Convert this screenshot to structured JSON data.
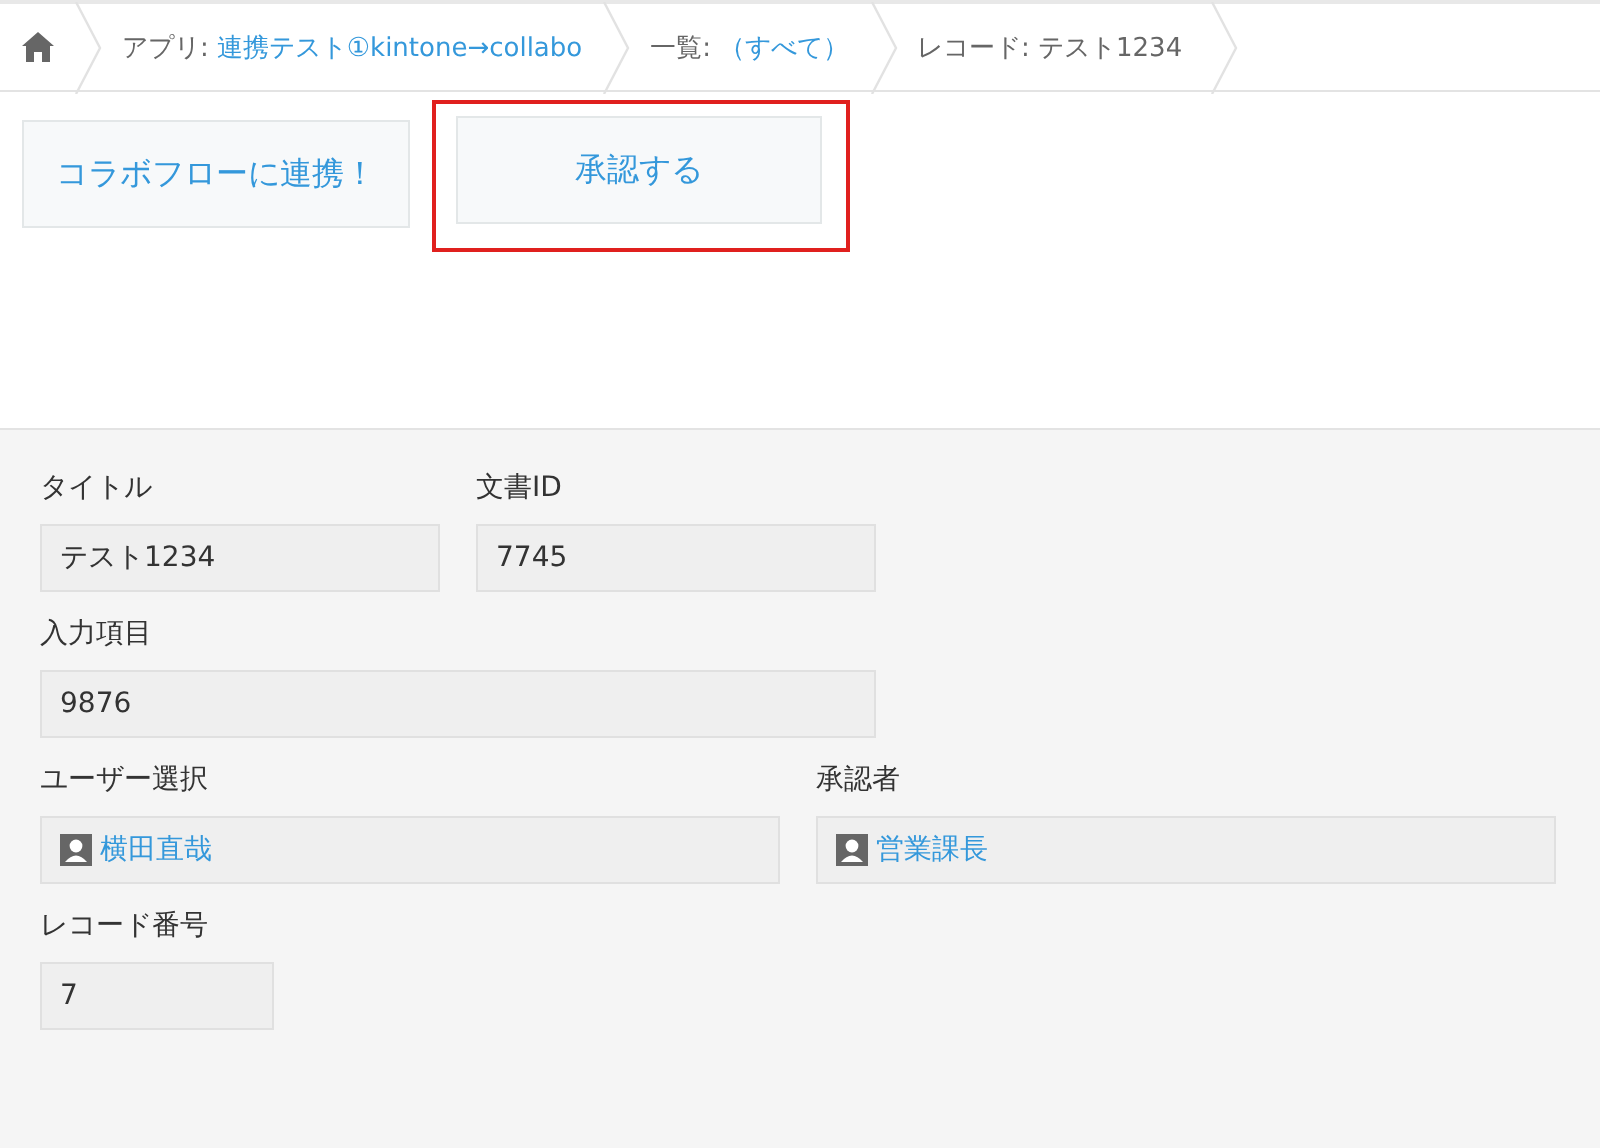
{
  "breadcrumb": [
    {
      "kind": "home"
    },
    {
      "kind": "link",
      "label": "アプリ:",
      "link": "連携テスト①kintone→collabo"
    },
    {
      "kind": "link",
      "label": "一覧:",
      "link": "（すべて）"
    },
    {
      "kind": "text",
      "label": "レコード: テスト1234"
    }
  ],
  "buttons": [
    {
      "label": "コラボフローに連携！",
      "highlighted": false
    },
    {
      "label": "承認する",
      "highlighted": true
    }
  ],
  "field_rows": [
    [
      {
        "label": "タイトル",
        "kind": "text",
        "value": "テスト1234"
      },
      {
        "label": "文書ID",
        "kind": "text",
        "value": "7745"
      }
    ],
    [
      {
        "label": "入力項目",
        "kind": "text",
        "value": "9876"
      }
    ],
    [
      {
        "label": "ユーザー選択",
        "kind": "user",
        "value": "横田直哉"
      },
      {
        "label": "承認者",
        "kind": "user",
        "value": "営業課長"
      }
    ],
    [
      {
        "label": "レコード番号",
        "kind": "text",
        "value": "7"
      }
    ]
  ]
}
